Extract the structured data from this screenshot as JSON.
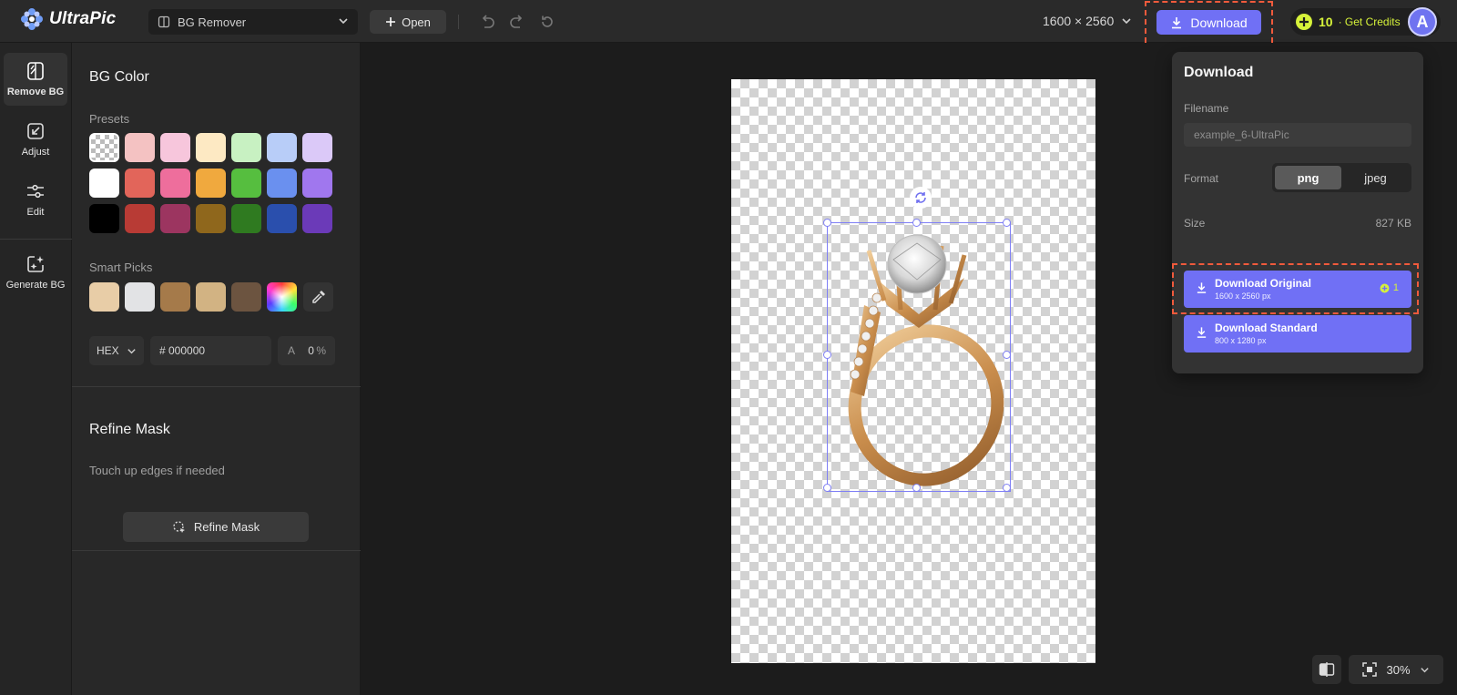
{
  "app": {
    "brand": "UltraPic"
  },
  "toolbar": {
    "tool_select": "BG Remover",
    "open_label": "Open",
    "dimensions": "1600 × 2560",
    "download_label": "Download",
    "credits": "10",
    "get_credits": "· Get Credits",
    "avatar_letter": "A"
  },
  "rail": {
    "items": [
      {
        "label": "Remove BG",
        "icon": "remove-bg-icon"
      },
      {
        "label": "Adjust",
        "icon": "adjust-icon"
      },
      {
        "label": "Edit",
        "icon": "sliders-icon"
      },
      {
        "label": "Generate BG",
        "icon": "sparkle-image-icon"
      }
    ]
  },
  "panel": {
    "bg_color_title": "BG Color",
    "presets_label": "Presets",
    "presets": [
      [
        "transparent",
        "#f4c2c2",
        "#f7c6dc",
        "#fde9c3",
        "#c8f1c2",
        "#b8cdf8",
        "#dbc9f8"
      ],
      [
        "#ffffff",
        "#e2655a",
        "#ee6e9c",
        "#f0a93e",
        "#56be3f",
        "#6a90ef",
        "#a077ee"
      ],
      [
        "#000000",
        "#b83b35",
        "#9c3560",
        "#8f671c",
        "#2f7a20",
        "#2a4fad",
        "#6b3ab8"
      ]
    ],
    "smart_picks_label": "Smart Picks",
    "smart_picks": [
      "#e8cda7",
      "#e2e3e5",
      "#a57a4a",
      "#d2b383",
      "#6c5440",
      "gradient"
    ],
    "format": "HEX",
    "hex_value": "# 000000",
    "alpha_label": "A",
    "alpha_value": "0",
    "alpha_unit": "%",
    "refine_title": "Refine Mask",
    "refine_sub": "Touch up edges if needed",
    "refine_button": "Refine Mask"
  },
  "canvas": {
    "zoom": "30%"
  },
  "download_popover": {
    "title": "Download",
    "filename_label": "Filename",
    "filename_value": "example_6-UltraPic",
    "format_label": "Format",
    "formats": [
      "png",
      "jpeg"
    ],
    "format_selected": "png",
    "size_label": "Size",
    "size_value": "827 KB",
    "original": {
      "title": "Download Original",
      "dims": "1600 x 2560 px",
      "cost": "1"
    },
    "standard": {
      "title": "Download Standard",
      "dims": "800 x 1280 px"
    }
  },
  "colors": {
    "accent": "#7070f5",
    "credit": "#d6f23a",
    "highlight": "#f05a3c"
  }
}
